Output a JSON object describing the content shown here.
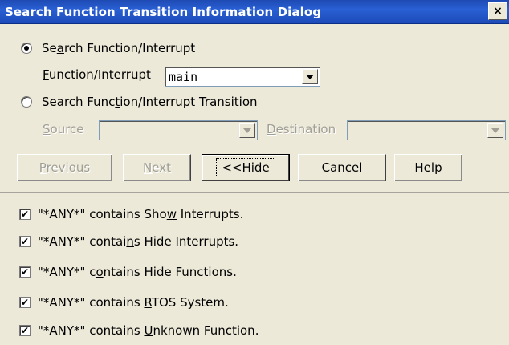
{
  "window": {
    "title": "Search Function Transition Information Dialog",
    "close_glyph": "×"
  },
  "search_mode": {
    "function_radio": {
      "label_pre": "Se",
      "label_u": "a",
      "label_post": "rch Function/Interrupt",
      "selected": true
    },
    "function_field": {
      "label_u": "F",
      "label_post": "unction/Interrupt",
      "value": "main"
    },
    "transition_radio": {
      "label_pre": "Search Func",
      "label_u": "t",
      "label_post": "ion/Interrupt Transition",
      "selected": false
    },
    "source": {
      "label_u": "S",
      "label_post": "ource",
      "value": ""
    },
    "destination": {
      "label_u": "D",
      "label_post": "estination",
      "value": ""
    }
  },
  "buttons": {
    "previous": {
      "u": "P",
      "rest": "revious"
    },
    "next": {
      "u": "N",
      "rest": "ext"
    },
    "hide": {
      "pre": "<<Hid",
      "u": "e",
      "rest": ""
    },
    "cancel": {
      "u": "C",
      "rest": "ancel"
    },
    "help": {
      "u": "H",
      "rest": "elp"
    }
  },
  "options": [
    {
      "pre": "\"*ANY*\" contains Sho",
      "u": "w",
      "post": " Interrupts.",
      "checked": true
    },
    {
      "pre": "\"*ANY*\" contai",
      "u": "n",
      "post": "s Hide Interrupts.",
      "checked": true
    },
    {
      "pre": "\"*ANY*\" c",
      "u": "o",
      "post": "ntains Hide Functions.",
      "checked": true
    },
    {
      "pre": "\"*ANY*\" contains ",
      "u": "R",
      "post": "TOS System.",
      "checked": true
    },
    {
      "pre": "\"*ANY*\" contains ",
      "u": "U",
      "post": "nknown Function.",
      "checked": true
    }
  ]
}
